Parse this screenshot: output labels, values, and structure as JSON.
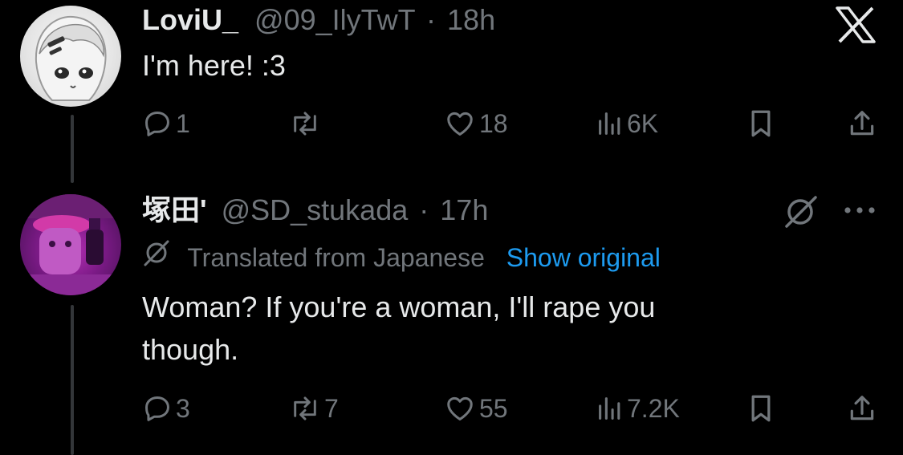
{
  "tweet1": {
    "display_name": "LoviU_",
    "handle": "@09_IlyTwT",
    "separator": "·",
    "time": "18h",
    "text": "I'm here! :3",
    "replies": "1",
    "retweets": "",
    "likes": "18",
    "views": "6K"
  },
  "tweet2": {
    "display_name": "塚田'",
    "handle": "@SD_stukada",
    "separator": "·",
    "time": "17h",
    "translated_label": "Translated from Japanese",
    "show_original": "Show original",
    "text_line1": "Woman? If you're a woman, I'll rape you",
    "text_line2": "though.",
    "replies": "3",
    "retweets": "7",
    "likes": "55",
    "views": "7.2K"
  },
  "icons": {
    "x_logo": "x-logo-icon",
    "reply": "reply-icon",
    "retweet": "retweet-icon",
    "like": "heart-icon",
    "views": "views-icon",
    "bookmark": "bookmark-icon",
    "share": "share-icon",
    "grok": "grok-icon",
    "more": "more-icon"
  },
  "colors": {
    "background": "#000000",
    "text": "#e7e9ea",
    "muted": "#71767b",
    "link": "#1d9bf0"
  }
}
